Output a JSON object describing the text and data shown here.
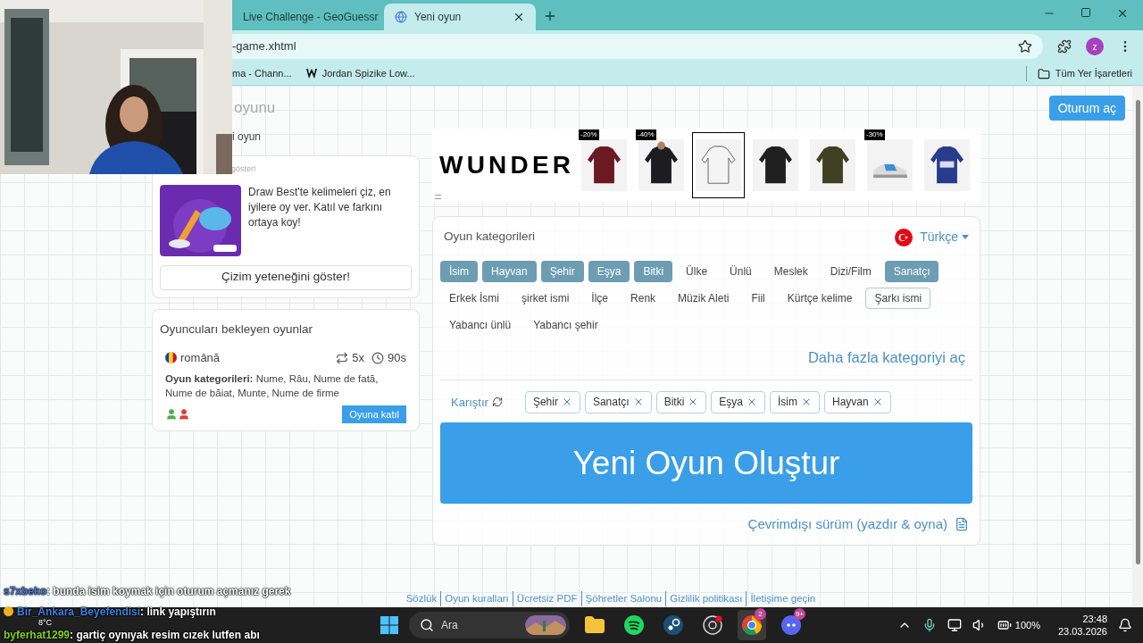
{
  "browser": {
    "tabs": [
      {
        "title": "Live Challenge - GeoGuessr",
        "selected": false
      },
      {
        "title": "Yeni oyun",
        "selected": true
      }
    ],
    "address": "-game.xhtml",
    "profile": "z",
    "bookmarks": [
      {
        "title": "ma - Chann...",
        "kind": "plain"
      },
      {
        "title": "Jordan Spizike Low...",
        "kind": "logo"
      }
    ],
    "all_bookmarks": "Tüm Yer İşaretleri"
  },
  "page": {
    "title": "oyunu",
    "login_button": "Oturum aç",
    "breadcrumb": "i oyun",
    "promo": {
      "caption": "göster!",
      "text": "Draw Best'te kelimeleri çiz, en iyilere oy ver. Katıl ve farkını ortaya koy!",
      "button": "Çizim yeteneğini göster!"
    },
    "waiting": {
      "title": "Oyuncuları bekleyen oyunlar",
      "games": [
        {
          "language": "română",
          "rounds": "5x",
          "time": "90s",
          "categories_label": "Oyun kategorileri:",
          "categories": "Nume, Râu, Nume de fată, Nume de băiat, Munte, Nume de firme",
          "players": [
            {
              "color": "#4caf50"
            },
            {
              "color": "#e53935"
            }
          ],
          "join": "Oyuna katıl"
        }
      ]
    },
    "ad": {
      "brand": "WUNDER",
      "products": [
        {
          "badge": "-20%",
          "selected": false
        },
        {
          "badge": "-40%",
          "selected": false
        },
        {
          "selected": true
        },
        {
          "selected": false
        },
        {
          "selected": false
        },
        {
          "badge": "-30%",
          "selected": false
        },
        {
          "selected": false
        }
      ]
    },
    "categories": {
      "title": "Oyun kategorileri",
      "language": "Türkçe",
      "items": [
        {
          "label": "İsim",
          "selected": true,
          "highlighted": false
        },
        {
          "label": "Hayvan",
          "selected": true,
          "highlighted": false
        },
        {
          "label": "Şehir",
          "selected": true,
          "highlighted": false
        },
        {
          "label": "Eşya",
          "selected": true,
          "highlighted": false
        },
        {
          "label": "Bitki",
          "selected": true,
          "highlighted": false
        },
        {
          "label": "Ülke",
          "selected": false,
          "highlighted": false
        },
        {
          "label": "Ünlü",
          "selected": false,
          "highlighted": false
        },
        {
          "label": "Meslek",
          "selected": false,
          "highlighted": false
        },
        {
          "label": "Dizi/Film",
          "selected": false,
          "highlighted": false
        },
        {
          "label": "Sanatçı",
          "selected": true,
          "highlighted": false
        },
        {
          "label": "Erkek İsmi",
          "selected": false,
          "highlighted": false
        },
        {
          "label": "şirket ismi",
          "selected": false,
          "highlighted": false
        },
        {
          "label": "İlçe",
          "selected": false,
          "highlighted": false
        },
        {
          "label": "Renk",
          "selected": false,
          "highlighted": false
        },
        {
          "label": "Müzik Aleti",
          "selected": false,
          "highlighted": false
        },
        {
          "label": "Fiil",
          "selected": false,
          "highlighted": false
        },
        {
          "label": "Kürtçe kelime",
          "selected": false,
          "highlighted": false
        },
        {
          "label": "Şarkı ismi",
          "selected": false,
          "highlighted": true
        },
        {
          "label": "Yabancı ünlü",
          "selected": false,
          "highlighted": false
        },
        {
          "label": "Yabancı şehir",
          "selected": false,
          "highlighted": false
        }
      ],
      "more": "Daha fazla kategoriyi aç",
      "shuffle": "Karıştır",
      "chosen": [
        "Şehir",
        "Sanatçı",
        "Bitki",
        "Eşya",
        "İsim",
        "Hayvan"
      ],
      "create": "Yeni Oyun Oluştur",
      "offline": "Çevrimdışı sürüm (yazdır & oyna)"
    },
    "footer": [
      "Sözlük",
      "Oyun kuralları",
      "Ücretsiz PDF",
      "Şöhretler Salonu",
      "Gizlilik politikası",
      "İletişime geçin"
    ]
  },
  "chat": [
    {
      "user": "s7xbeko",
      "message": ": bunda isim koymak için oturum açmanız gerek",
      "color": "#4a78d0",
      "badge": false
    },
    {
      "user": "Bir_Ankara_Beyefendisi",
      "message": ": link yapıştırın",
      "color": "#3f7fe0",
      "badge": true
    },
    {
      "user": "byferhat1299",
      "message": ": gartiç oynıyak resim cızek lutfen abı",
      "color": "#7ed321",
      "badge": false
    }
  ],
  "taskbar": {
    "weather": "8°C",
    "search": "Ara",
    "apps": [
      {
        "kind": "folder",
        "active": false
      },
      {
        "kind": "spotify",
        "active": false
      },
      {
        "kind": "steam",
        "active": false
      },
      {
        "kind": "obs",
        "active": false
      },
      {
        "kind": "chrome",
        "badge": "2",
        "active": true
      },
      {
        "kind": "discord",
        "badge": "9+",
        "active": false
      }
    ],
    "battery": "100%",
    "time": "23:48",
    "date": "23.03.2026"
  }
}
